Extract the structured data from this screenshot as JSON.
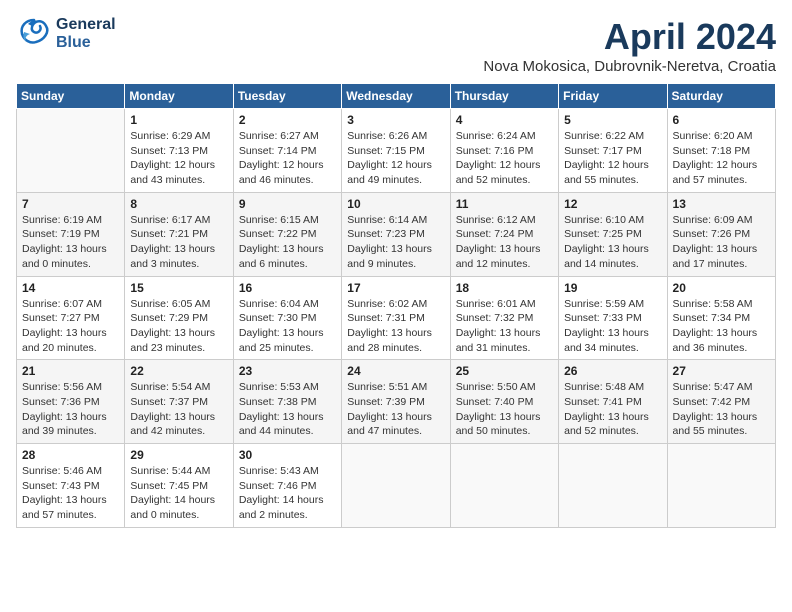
{
  "header": {
    "logo_line1": "General",
    "logo_line2": "Blue",
    "title": "April 2024",
    "subtitle": "Nova Mokosica, Dubrovnik-Neretva, Croatia"
  },
  "days_of_week": [
    "Sunday",
    "Monday",
    "Tuesday",
    "Wednesday",
    "Thursday",
    "Friday",
    "Saturday"
  ],
  "weeks": [
    [
      {
        "day": "",
        "info": ""
      },
      {
        "day": "1",
        "info": "Sunrise: 6:29 AM\nSunset: 7:13 PM\nDaylight: 12 hours\nand 43 minutes."
      },
      {
        "day": "2",
        "info": "Sunrise: 6:27 AM\nSunset: 7:14 PM\nDaylight: 12 hours\nand 46 minutes."
      },
      {
        "day": "3",
        "info": "Sunrise: 6:26 AM\nSunset: 7:15 PM\nDaylight: 12 hours\nand 49 minutes."
      },
      {
        "day": "4",
        "info": "Sunrise: 6:24 AM\nSunset: 7:16 PM\nDaylight: 12 hours\nand 52 minutes."
      },
      {
        "day": "5",
        "info": "Sunrise: 6:22 AM\nSunset: 7:17 PM\nDaylight: 12 hours\nand 55 minutes."
      },
      {
        "day": "6",
        "info": "Sunrise: 6:20 AM\nSunset: 7:18 PM\nDaylight: 12 hours\nand 57 minutes."
      }
    ],
    [
      {
        "day": "7",
        "info": "Sunrise: 6:19 AM\nSunset: 7:19 PM\nDaylight: 13 hours\nand 0 minutes."
      },
      {
        "day": "8",
        "info": "Sunrise: 6:17 AM\nSunset: 7:21 PM\nDaylight: 13 hours\nand 3 minutes."
      },
      {
        "day": "9",
        "info": "Sunrise: 6:15 AM\nSunset: 7:22 PM\nDaylight: 13 hours\nand 6 minutes."
      },
      {
        "day": "10",
        "info": "Sunrise: 6:14 AM\nSunset: 7:23 PM\nDaylight: 13 hours\nand 9 minutes."
      },
      {
        "day": "11",
        "info": "Sunrise: 6:12 AM\nSunset: 7:24 PM\nDaylight: 13 hours\nand 12 minutes."
      },
      {
        "day": "12",
        "info": "Sunrise: 6:10 AM\nSunset: 7:25 PM\nDaylight: 13 hours\nand 14 minutes."
      },
      {
        "day": "13",
        "info": "Sunrise: 6:09 AM\nSunset: 7:26 PM\nDaylight: 13 hours\nand 17 minutes."
      }
    ],
    [
      {
        "day": "14",
        "info": "Sunrise: 6:07 AM\nSunset: 7:27 PM\nDaylight: 13 hours\nand 20 minutes."
      },
      {
        "day": "15",
        "info": "Sunrise: 6:05 AM\nSunset: 7:29 PM\nDaylight: 13 hours\nand 23 minutes."
      },
      {
        "day": "16",
        "info": "Sunrise: 6:04 AM\nSunset: 7:30 PM\nDaylight: 13 hours\nand 25 minutes."
      },
      {
        "day": "17",
        "info": "Sunrise: 6:02 AM\nSunset: 7:31 PM\nDaylight: 13 hours\nand 28 minutes."
      },
      {
        "day": "18",
        "info": "Sunrise: 6:01 AM\nSunset: 7:32 PM\nDaylight: 13 hours\nand 31 minutes."
      },
      {
        "day": "19",
        "info": "Sunrise: 5:59 AM\nSunset: 7:33 PM\nDaylight: 13 hours\nand 34 minutes."
      },
      {
        "day": "20",
        "info": "Sunrise: 5:58 AM\nSunset: 7:34 PM\nDaylight: 13 hours\nand 36 minutes."
      }
    ],
    [
      {
        "day": "21",
        "info": "Sunrise: 5:56 AM\nSunset: 7:36 PM\nDaylight: 13 hours\nand 39 minutes."
      },
      {
        "day": "22",
        "info": "Sunrise: 5:54 AM\nSunset: 7:37 PM\nDaylight: 13 hours\nand 42 minutes."
      },
      {
        "day": "23",
        "info": "Sunrise: 5:53 AM\nSunset: 7:38 PM\nDaylight: 13 hours\nand 44 minutes."
      },
      {
        "day": "24",
        "info": "Sunrise: 5:51 AM\nSunset: 7:39 PM\nDaylight: 13 hours\nand 47 minutes."
      },
      {
        "day": "25",
        "info": "Sunrise: 5:50 AM\nSunset: 7:40 PM\nDaylight: 13 hours\nand 50 minutes."
      },
      {
        "day": "26",
        "info": "Sunrise: 5:48 AM\nSunset: 7:41 PM\nDaylight: 13 hours\nand 52 minutes."
      },
      {
        "day": "27",
        "info": "Sunrise: 5:47 AM\nSunset: 7:42 PM\nDaylight: 13 hours\nand 55 minutes."
      }
    ],
    [
      {
        "day": "28",
        "info": "Sunrise: 5:46 AM\nSunset: 7:43 PM\nDaylight: 13 hours\nand 57 minutes."
      },
      {
        "day": "29",
        "info": "Sunrise: 5:44 AM\nSunset: 7:45 PM\nDaylight: 14 hours\nand 0 minutes."
      },
      {
        "day": "30",
        "info": "Sunrise: 5:43 AM\nSunset: 7:46 PM\nDaylight: 14 hours\nand 2 minutes."
      },
      {
        "day": "",
        "info": ""
      },
      {
        "day": "",
        "info": ""
      },
      {
        "day": "",
        "info": ""
      },
      {
        "day": "",
        "info": ""
      }
    ]
  ]
}
